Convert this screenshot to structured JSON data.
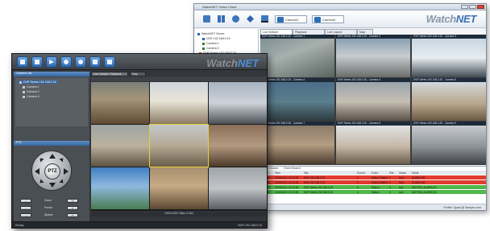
{
  "back_window": {
    "title": "WatchNET Vision Client",
    "logo": {
      "brand1": "Watch",
      "brand2": "NET"
    },
    "toolbar": {
      "icons": [
        "layout-icon",
        "grid-icon",
        "ptz-icon",
        "arrows-icon",
        "display-icon",
        "camera-icon"
      ],
      "selectors": [
        "Camera1",
        "Camera2"
      ]
    },
    "tree": [
      {
        "label": "WatchNET Server",
        "color": "#2a64b0"
      },
      {
        "label": "NVR 192.168.0.10",
        "color": "#2a64b0"
      },
      {
        "label": "Camera 1",
        "color": "#3a7d2c"
      },
      {
        "label": "Camera 2",
        "color": "#3a7d2c"
      },
      {
        "label": "DVR Series 192.168.0.20",
        "color": "#d33a2c"
      },
      {
        "label": "Camera 1",
        "color": "#3a7d2c"
      },
      {
        "label": "Camera 2",
        "color": "#3a7d2c"
      },
      {
        "label": "Camera 3",
        "color": "#3a7d2c"
      }
    ],
    "tabs": [
      "Live Default",
      "Playback",
      "Live Layout",
      "Map"
    ],
    "cameras": [
      {
        "label": "DVR Series 192.168.0.20 - Camera 1"
      },
      {
        "label": "DVR Series 192.168.0.20 - Camera 2"
      },
      {
        "label": "DVR Series 192.168.0.20 - Camera 3"
      },
      {
        "label": "DVR Series 192.168.0.20 - Camera 4"
      },
      {
        "label": "DVR Series 192.168.0.20 - Camera 5"
      },
      {
        "label": "DVR Series 192.168.0.20 - Camera 6"
      },
      {
        "label": "DVR Series 192.168.0.20 - Camera 7"
      },
      {
        "label": "DVR Series 192.168.0.20 - Camera 8"
      },
      {
        "label": "DVR Series 192.168.0.20 - Camera 9"
      }
    ],
    "events": {
      "tabs": [
        "Event Source",
        "Event Search"
      ],
      "headers": [
        "Type",
        "Time",
        "Site",
        "Source",
        "Event",
        "Site",
        "Status",
        "Detail"
      ],
      "rows": [
        {
          "type": "Alarm",
          "time": "2015/01/01 10:23:33",
          "site": "NVR 192.168.0.10",
          "source": "1",
          "event": "Motion Detect",
          "site2": "1",
          "status": "New",
          "detail": "ALARM IN1",
          "color": "#e23b2f"
        },
        {
          "type": "Alarm",
          "time": "2015/01/01 10:23:34",
          "site": "NVR 192.168.0.10",
          "source": "2",
          "event": "Motion Detect",
          "site2": "2",
          "status": "New",
          "detail": "ALARM IN2",
          "color": "#e23b2f"
        },
        {
          "type": "Event",
          "time": "2015/01/01 10:23:35",
          "site": "DVR Series 192.168.0.20",
          "source": "3",
          "event": "Motion",
          "site2": "3",
          "status": "Ack",
          "detail": "MOTION_ALARM_IN",
          "color": "#4fb84a"
        },
        {
          "type": "Event",
          "time": "2015/01/01 10:23:36",
          "site": "DVR Series 192.168.0.20",
          "source": "4",
          "event": "Motion",
          "site2": "4",
          "status": "Ack",
          "detail": "MOTION_ALARM_IN",
          "color": "#4fb84a"
        }
      ]
    },
    "status": "Profile: Quad  @  Sample.com"
  },
  "front_window": {
    "logo": {
      "brand1": "Watch",
      "brand2": "NET"
    },
    "toolbar_icons": [
      "home-icon",
      "grid-icon",
      "play-icon",
      "search-icon",
      "globe-icon",
      "settings-icon",
      "help-icon"
    ],
    "panel_title": "Camera List",
    "tree": [
      {
        "label": "DVR Series 192.168.0.20",
        "selected": true
      },
      {
        "label": "Camera 1",
        "selected": false
      },
      {
        "label": "Camera 2",
        "selected": false
      },
      {
        "label": "Camera 3",
        "selected": false
      }
    ],
    "ptz_title": "PTZ",
    "ptz_label": "PTZ",
    "ptz_controls": [
      {
        "label": "Zoom",
        "minus": "-",
        "plus": "+"
      },
      {
        "label": "Focus",
        "minus": "-",
        "plus": "+"
      },
      {
        "label": "Speed",
        "minus": "-",
        "plus": "+"
      }
    ],
    "tabs": [
      "Live Default / Playback",
      "Map"
    ],
    "stream_bar": "1920x1080  25fps  H.264",
    "status": {
      "left": "Ready",
      "right": "NVR 192.168.0.10"
    }
  }
}
